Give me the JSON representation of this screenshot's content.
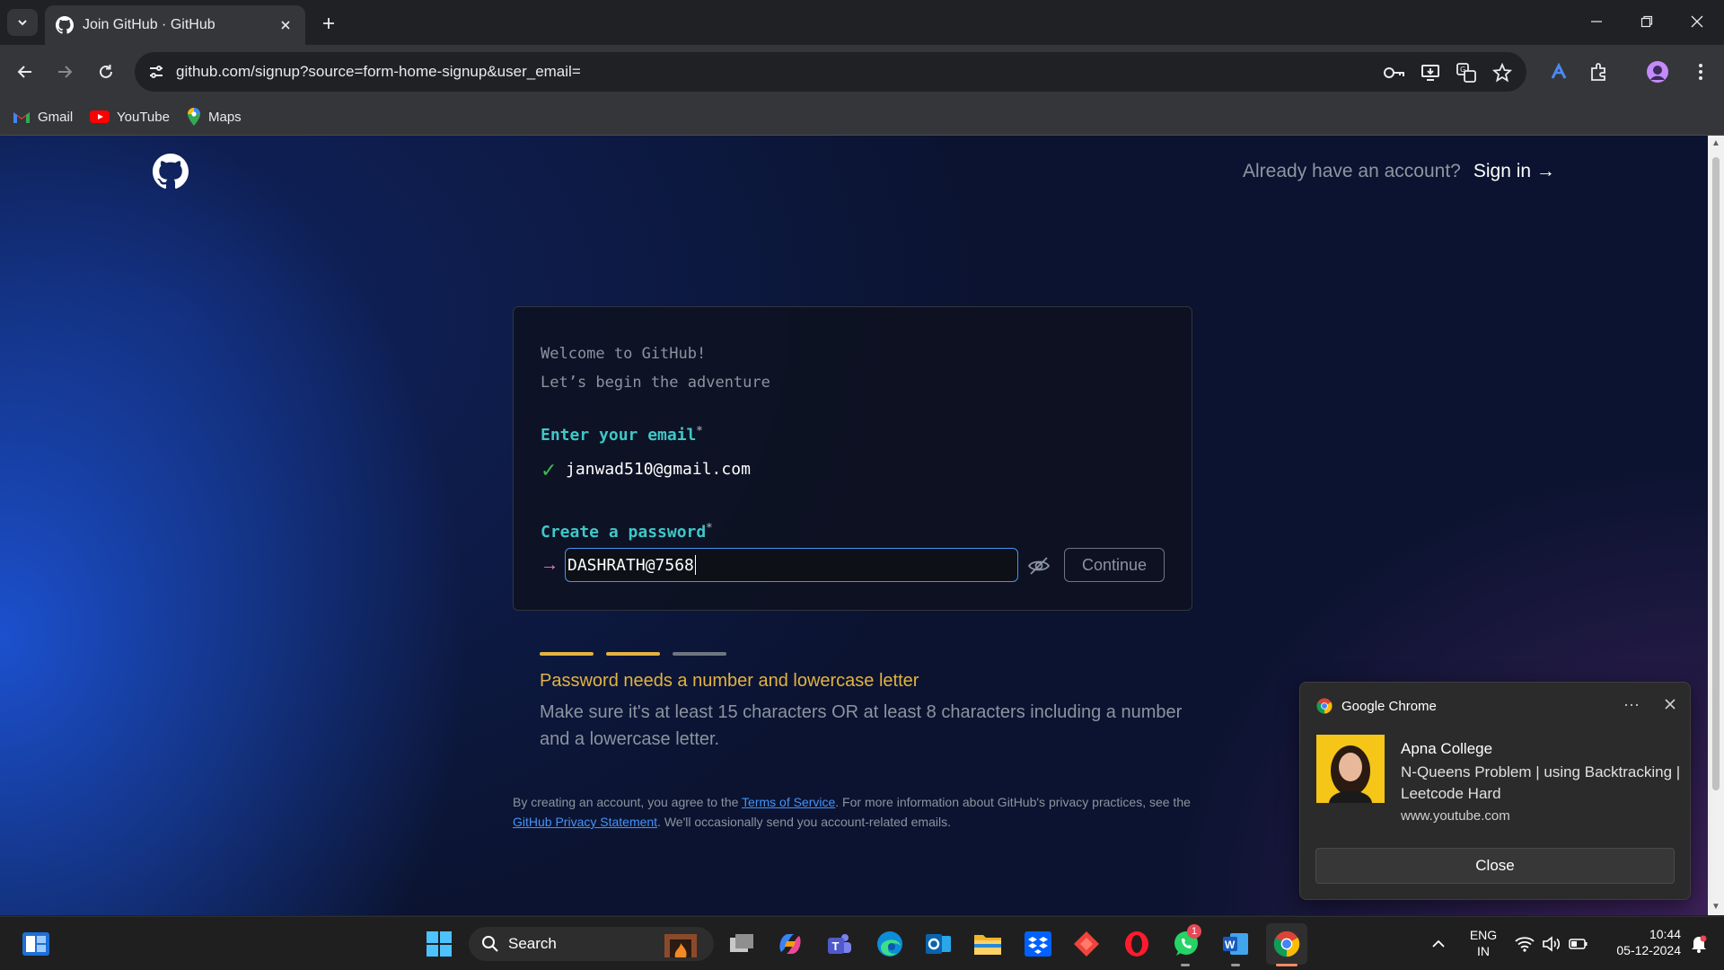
{
  "browser": {
    "tab_title": "Join GitHub · GitHub",
    "url": "github.com/signup?source=form-home-signup&user_email=",
    "bookmarks": [
      {
        "label": "Gmail",
        "icon": "gmail-icon"
      },
      {
        "label": "YouTube",
        "icon": "youtube-icon"
      },
      {
        "label": "Maps",
        "icon": "maps-icon"
      }
    ]
  },
  "header": {
    "already_text": "Already have an account?",
    "signin_label": "Sign in →"
  },
  "form": {
    "welcome_line1": "Welcome to GitHub!",
    "welcome_line2": "Let’s begin the adventure",
    "email_label": "Enter your email",
    "email_value": "janwad510@gmail.com",
    "password_label": "Create a password",
    "password_value": "DASHRATH@7568",
    "continue_label": "Continue",
    "required_mark": "*",
    "check_glyph": "✓",
    "arrow_glyph": "→"
  },
  "password_strength": {
    "segments": [
      "#e3b341",
      "#e3b341",
      "#6e7681"
    ],
    "warning": "Password needs a number and lowercase letter",
    "help": "Make sure it's at least 15 characters OR at least 8 characters including a number and a lowercase letter."
  },
  "terms": {
    "prefix": "By creating an account, you agree to the ",
    "tos_link": "Terms of Service",
    "middle": ". For more information about GitHub's privacy practices, see the ",
    "privacy_link": "GitHub Privacy Statement",
    "suffix": ". We'll occasionally send you account-related emails."
  },
  "notification": {
    "app_name": "Google Chrome",
    "more": "···",
    "title": "Apna College",
    "body": "N-Queens Problem | using Backtracking | Leetcode Hard",
    "source": "www.youtube.com",
    "button": "Close"
  },
  "taskbar": {
    "search_label": "Search",
    "whatsapp_badge": "1",
    "lang_line1": "ENG",
    "lang_line2": "IN",
    "time": "10:44",
    "date": "05-12-2024"
  },
  "colors": {
    "accent_teal": "#3fc7c7",
    "warning_yellow": "#e3b341",
    "link_blue": "#4493f8",
    "success_green": "#3fb950"
  }
}
